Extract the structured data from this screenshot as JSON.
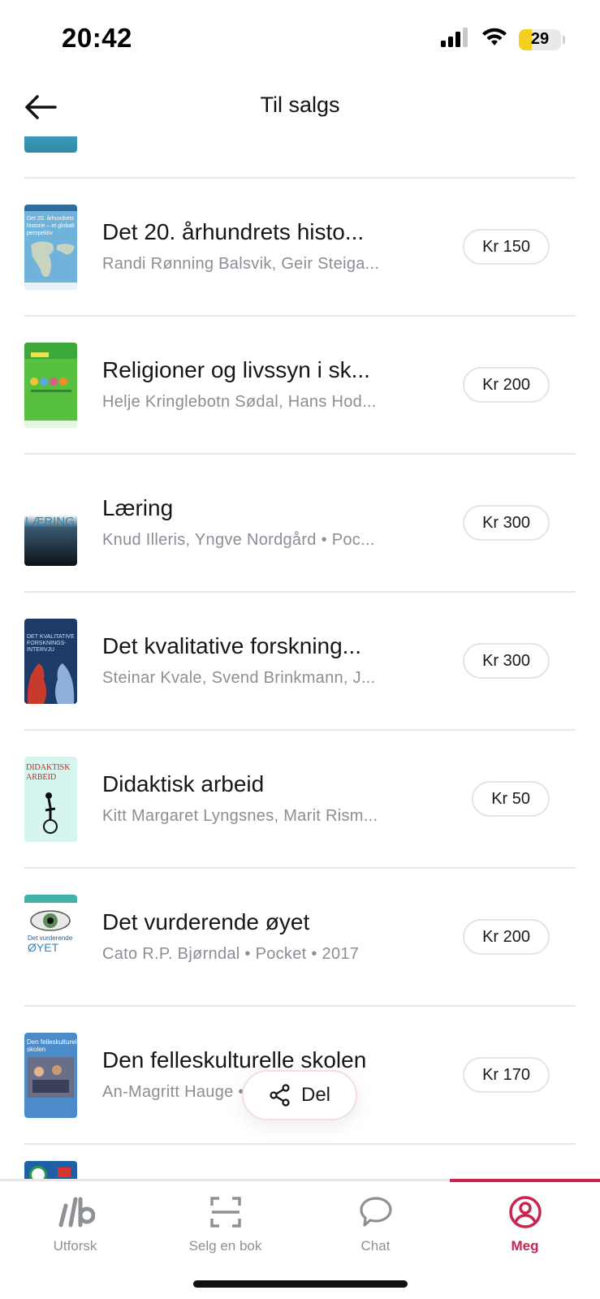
{
  "status_bar": {
    "time": "20:42",
    "battery": "29"
  },
  "header": {
    "title": "Til salgs"
  },
  "books": [
    {
      "title": "Det 20. århundrets histo...",
      "meta": "Randi Rønning Balsvik, Geir Steiga...",
      "price": "Kr 150",
      "cover": {
        "text": "Det 20. århundrets historie – et globalt perspektiv",
        "bg": "#5fa8d0"
      }
    },
    {
      "title": "Religioner og livssyn i sk...",
      "meta": "Helje Kringlebotn Sødal, Hans Hod...",
      "price": "Kr 200",
      "cover": {
        "text": "",
        "bg": "#4cb84a"
      }
    },
    {
      "title": "Læring",
      "meta": "Knud Illeris, Yngve Nordgård • Poc...",
      "price": "Kr 300",
      "cover": {
        "text": "LÆRING",
        "bg": "#1b2a3a"
      }
    },
    {
      "title": "Det kvalitative forskning...",
      "meta": "Steinar Kvale, Svend Brinkmann, J...",
      "price": "Kr 300",
      "cover": {
        "text": "DET KVALITATIVE FORSKNINGS-INTERVJU",
        "bg": "#2b4a78"
      }
    },
    {
      "title": "Didaktisk arbeid",
      "meta": "Kitt Margaret Lyngsnes, Marit Rism...",
      "price": "Kr 50",
      "cover": {
        "text": "DIDAKTISK ARBEID",
        "bg": "#d8f4ee"
      }
    },
    {
      "title": "Det vurderende øyet",
      "meta": "Cato R.P. Bjørndal • Pocket • 2017",
      "price": "Kr 200",
      "cover": {
        "text": "Det vurderende ØYET",
        "bg": "#ffffff"
      }
    },
    {
      "title": "Den felleskulturelle skolen",
      "meta": "An-Magritt Hauge • Pocket • 2014",
      "price": "Kr 170",
      "cover": {
        "text": "Den felleskulturelle skolen",
        "bg": "#3f7fc0"
      }
    }
  ],
  "share": {
    "label": "Del"
  },
  "tabs": [
    {
      "label": "Utforsk",
      "icon": "logo-icon",
      "active": false
    },
    {
      "label": "Selg en bok",
      "icon": "scan-icon",
      "active": false
    },
    {
      "label": "Chat",
      "icon": "chat-bubble-icon",
      "active": false
    },
    {
      "label": "Meg",
      "icon": "profile-icon",
      "active": true
    }
  ],
  "colors": {
    "accent": "#c8254f",
    "muted": "#8a8f95",
    "divider": "#e3e8ec"
  }
}
